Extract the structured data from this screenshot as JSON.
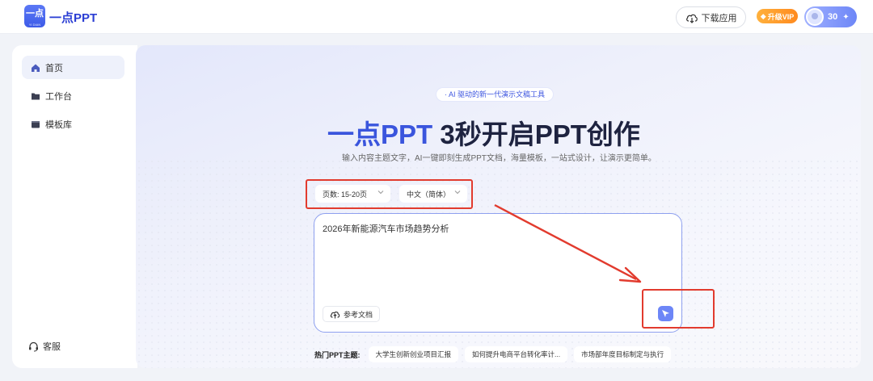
{
  "header": {
    "logo_text": "一点",
    "logo_sub": "YI DIAN",
    "brand": "一点PPT",
    "download_label": "下载应用",
    "vip_label": "升级VIP",
    "credits": "30"
  },
  "sidebar": {
    "items": [
      {
        "label": "首页",
        "icon": "home-icon",
        "active": true
      },
      {
        "label": "工作台",
        "icon": "folder-icon",
        "active": false
      },
      {
        "label": "模板库",
        "icon": "template-icon",
        "active": false
      }
    ],
    "service_label": "客服"
  },
  "main": {
    "tagline": "· AI 驱动的新一代演示文稿工具",
    "headline_brand": "一点PPT",
    "headline_rest": " 3秒开启PPT创作",
    "subline": "输入内容主题文字，AI一键即刻生成PPT文档，海量模板，一站式设计，让演示更简单。",
    "page_count_select": "页数: 15-20页",
    "language_select": "中文（简体）",
    "input_value": "2026年新能源汽车市场趋势分析",
    "reference_button": "参考文档",
    "hot_topics_label": "热门PPT主题:",
    "hot_topics": [
      "大学生创新创业项目汇报",
      "如何提升电商平台转化率计...",
      "市场部年度目标制定与执行"
    ]
  },
  "colors": {
    "brand_blue": "#3a55dd",
    "annotation_red": "#e23b2e",
    "vip_orange": "#ff9a2a"
  }
}
